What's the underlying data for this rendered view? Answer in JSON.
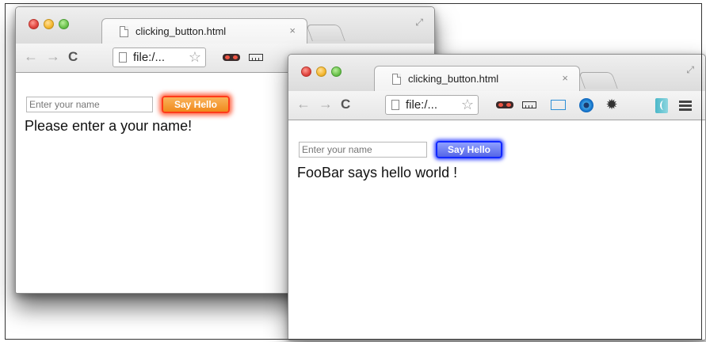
{
  "windows": [
    {
      "tab_title": "clicking_button.html",
      "tab_close": "×",
      "url": "file:/...",
      "input_placeholder": "Enter your name",
      "button_label": "Say Hello",
      "message": "Please enter a your name!"
    },
    {
      "tab_title": "clicking_button.html",
      "tab_close": "×",
      "url": "file:/...",
      "input_placeholder": "Enter your name",
      "button_label": "Say Hello",
      "message": "FooBar says hello world !"
    }
  ],
  "icons": {
    "back": "←",
    "forward": "→",
    "reload": "C",
    "bookmark": "☆",
    "fullscreen": "⤢",
    "settings": "✹"
  },
  "colors": {
    "back_button_fill": "#f08a1c",
    "back_button_glow": "#ff3b1a",
    "front_button_fill": "#5565e6",
    "front_button_glow": "#1028ff"
  }
}
